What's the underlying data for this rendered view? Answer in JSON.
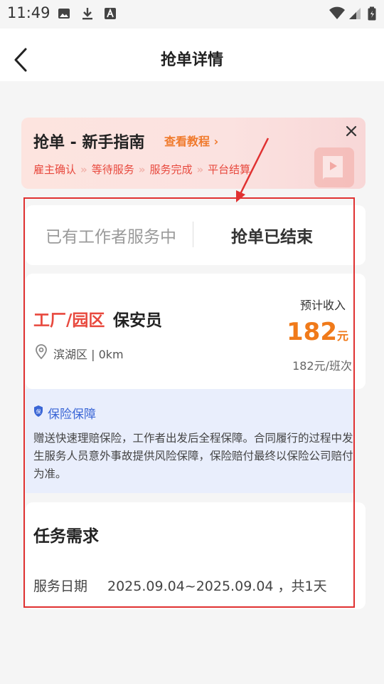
{
  "status_bar": {
    "time": "11:49",
    "icons": [
      "image-icon",
      "download-icon",
      "text-a-icon",
      "wifi-icon",
      "signal-icon",
      "battery-icon"
    ]
  },
  "header": {
    "title": "抢单详情",
    "back_icon": "chevron-left-icon"
  },
  "guide": {
    "title": "抢单 - 新手指南",
    "link": "查看教程",
    "steps": [
      "雇主确认",
      "等待服务",
      "服务完成",
      "平台结算"
    ],
    "close_icon": "close-icon",
    "decoration_icon": "book-icon"
  },
  "tabs": [
    {
      "label": "已有工作者服务中",
      "active": false
    },
    {
      "label": "抢单已结束",
      "active": true
    }
  ],
  "job": {
    "category": "工厂/园区",
    "name": "保安员",
    "location": "滨湖区 | 0km",
    "income_label": "预计收入",
    "price": "182",
    "price_unit": "元",
    "per_unit": "182元/班次"
  },
  "insurance": {
    "title": "保险保障",
    "text": "赠送快速理赔保险，工作者出发后全程保障。合同履行的过程中发生服务人员意外事故提供风险保障，保险赔付最终以保险公司赔付为准。"
  },
  "task": {
    "title": "任务需求",
    "date_label": "服务日期",
    "date_value": "2025.09.04~2025.09.04 ，共1天"
  },
  "colors": {
    "accent_red": "#e8493e",
    "accent_orange": "#f07a1a",
    "insurance_blue": "#3a66d6",
    "highlight_frame": "#e03131"
  }
}
